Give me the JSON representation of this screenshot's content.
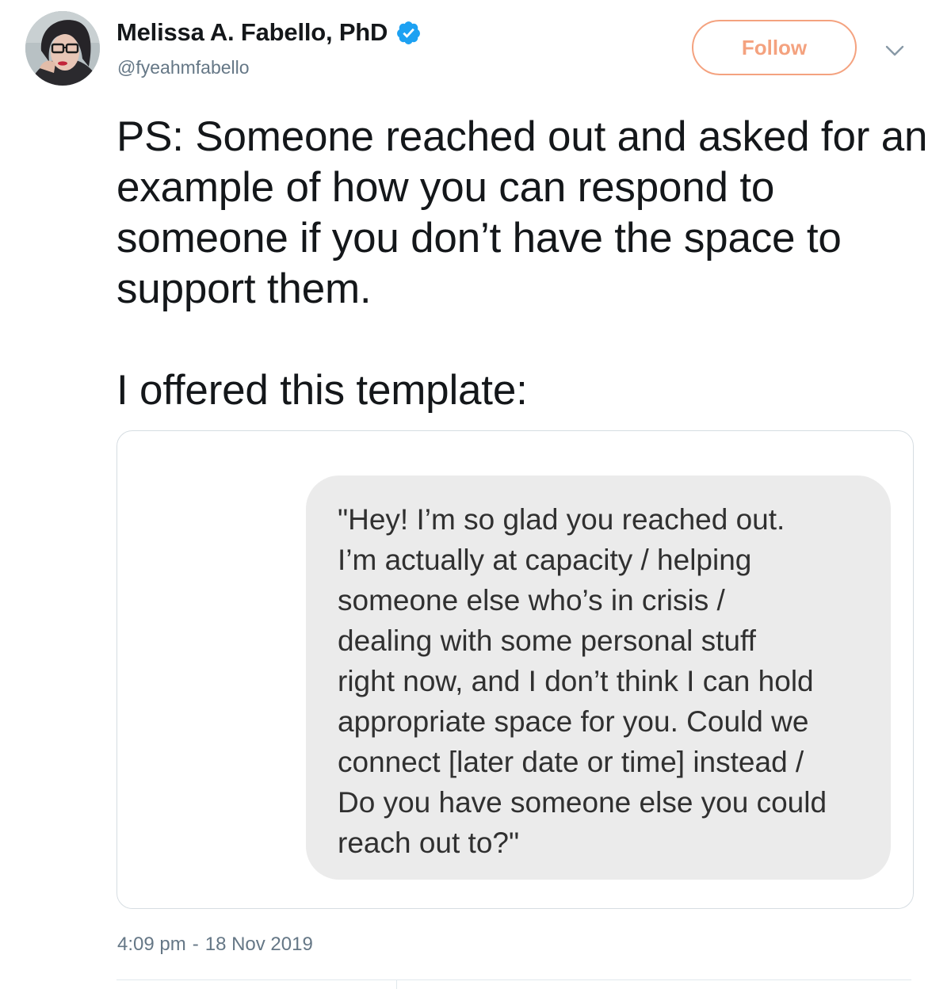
{
  "author": {
    "display_name": "Melissa A. Fabello, PhD",
    "handle": "@fyeahmfabello",
    "verified_icon": "verified-badge-icon",
    "avatar_icon": "profile-avatar"
  },
  "actions": {
    "follow_label": "Follow",
    "more_icon": "chevron-down-icon"
  },
  "tweet": {
    "paragraphs": [
      "PS: Someone reached out and asked for an example of how you can respond to someone if you don’t have the space to support them.",
      "I offered this template:"
    ]
  },
  "media": {
    "message_lines": [
      "\"Hey! I’m so glad you reached out.",
      "I’m actually at capacity / helping",
      "someone else who’s in crisis /",
      "dealing with some personal stuff",
      "right now, and I don’t think I can hold",
      "appropriate space for you. Could we",
      "connect [later date or time] instead /",
      "Do you have someone else you could",
      "reach out to?\""
    ]
  },
  "meta": {
    "time": "4:09 pm",
    "separator": "-",
    "date": "18 Nov 2019"
  },
  "colors": {
    "follow_accent": "#f4a27f",
    "verified_blue": "#1da1f2",
    "secondary_text": "#657786",
    "bubble_background": "#ebebeb"
  }
}
